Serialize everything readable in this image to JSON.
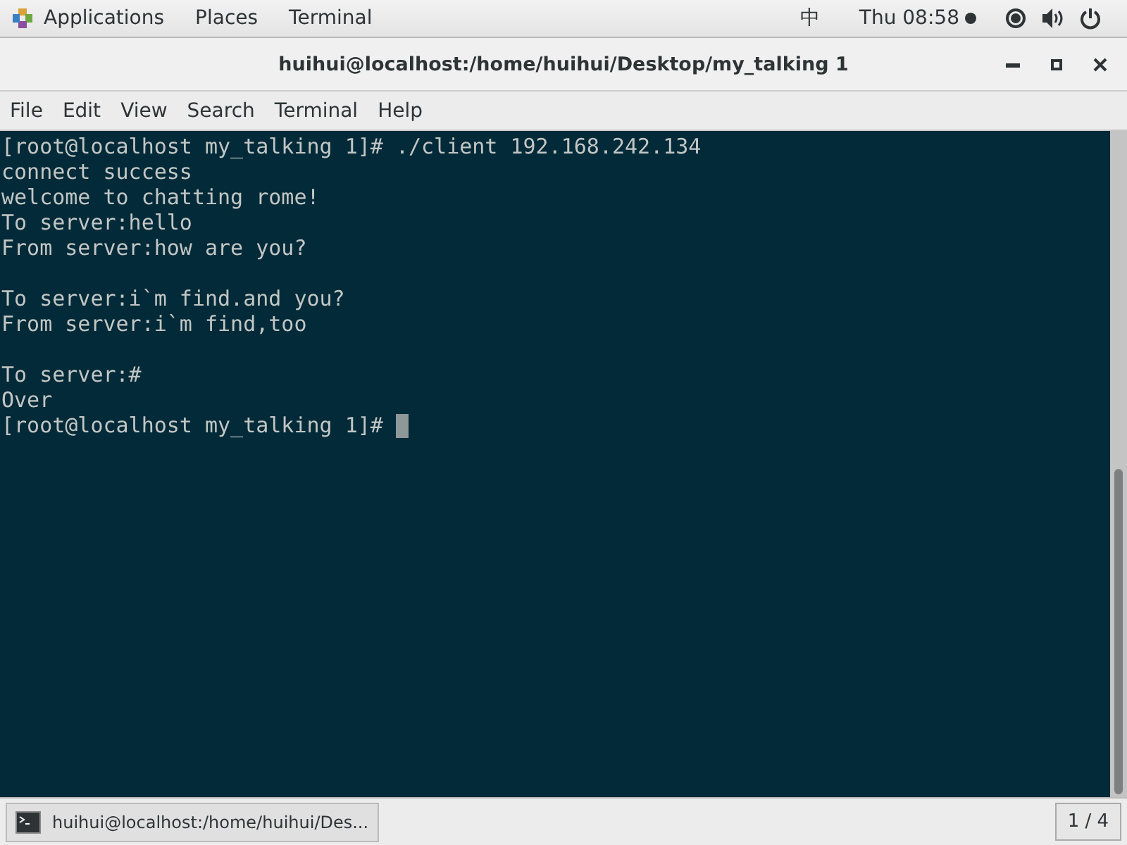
{
  "top_bar": {
    "menus": [
      "Applications",
      "Places",
      "Terminal"
    ],
    "input_method": "中",
    "clock": "Thu 08:58"
  },
  "window": {
    "title": "huihui@localhost:/home/huihui/Desktop/my_talking 1"
  },
  "menu_bar": [
    "File",
    "Edit",
    "View",
    "Search",
    "Terminal",
    "Help"
  ],
  "terminal": {
    "lines": [
      {
        "kind": "text",
        "text": "[root@localhost my_talking 1]# ./client 192.168.242.134"
      },
      {
        "kind": "text",
        "text": "connect success"
      },
      {
        "kind": "text",
        "text": "welcome to chatting rome!"
      },
      {
        "kind": "text",
        "text": "To server:hello"
      },
      {
        "kind": "text",
        "text": "From server:how are you?"
      },
      {
        "kind": "blank"
      },
      {
        "kind": "text",
        "text": "To server:i`m find.and you?"
      },
      {
        "kind": "text",
        "text": "From server:i`m find,too"
      },
      {
        "kind": "blank"
      },
      {
        "kind": "text",
        "text": "To server:#"
      },
      {
        "kind": "text",
        "text": "Over"
      },
      {
        "kind": "prompt",
        "text": "[root@localhost my_talking 1]#"
      }
    ]
  },
  "taskbar": {
    "window_button": "huihui@localhost:/home/huihui/Des...",
    "workspace": "1 / 4"
  }
}
